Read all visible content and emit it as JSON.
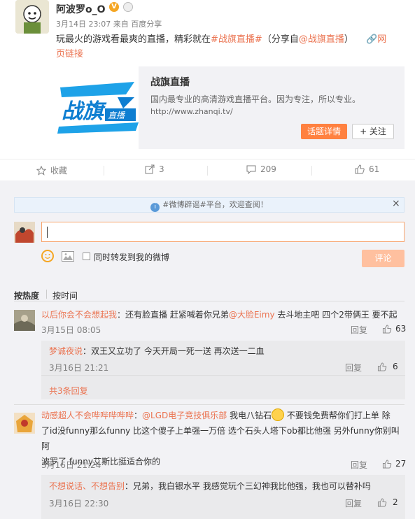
{
  "post": {
    "username": "阿波罗o_O",
    "verified_badge": "V",
    "time": "3月14日 23:07",
    "source": "来自 百度分享",
    "text_prefix": "玩最火的游戏看最爽的直播，精彩就在",
    "topic": "#战旗直播#",
    "text_mid": "（分享自",
    "share_from": "@战旗直播",
    "text_suffix": "）",
    "web_link_line1": "网",
    "web_link_line2": "页链接"
  },
  "card": {
    "logo_text": "战旗",
    "logo_sub": "直播",
    "title": "战旗直播",
    "description": "国内最专业的高清游戏直播平台。因为专注，所以专业。",
    "url": "http://www.zhanqi.tv/",
    "topic_button": "话题详情",
    "follow_button": "+ 关注"
  },
  "actions": {
    "favorite": "收藏",
    "forward": "3",
    "comment": "209",
    "like": "61"
  },
  "comment_box": {
    "notice": "#微博辟谣#平台，欢迎查阅！",
    "close": "×",
    "repost_label": "同时转发到我的微博",
    "submit": "评论"
  },
  "sort": {
    "hot": "按热度",
    "time": "按时间"
  },
  "comments": [
    {
      "user": "以后你会不会想起我",
      "text": "：还有脸直播  赶紧喊着你兄弟@大脸Eimy  去斗地主吧  四个2带俩王  要不起",
      "mention": "@大脸Eimy",
      "time": "3月15日 08:05",
      "reply": "回复",
      "likes": "63",
      "sub": {
        "user": "梦诚夜说",
        "text": "：双王又立功了 今天开局一死一送 再次送一二血",
        "time": "3月16日 21:21",
        "reply": "回复",
        "likes": "6"
      },
      "more": "共3条回复"
    },
    {
      "user": "动感超人不会哔哔哔哔哔",
      "text_line1_pre": "：",
      "mention": "@LGD电子竞技俱乐部",
      "text_line1_mid": " 我电八钻石",
      "text_line1_post": " 不要钱免费帮你们打上单  除",
      "text_line2": "了id没funny那么funny 比这个傻子上单强一万倍  选个石头人塔下ob都比他强  另外funny你别叫阿",
      "text_line3": "波罗了 funny艾斯比挺适合你的",
      "time": "3月16日 21:24",
      "reply": "回复",
      "likes": "27",
      "sub": {
        "user": "不想说话、不想告别",
        "text": "：兄弟，我白银水平 我感觉玩个三幻神我比他强，我也可以替补吗",
        "time": "3月16日 22:30",
        "reply": "回复",
        "likes": "2"
      }
    }
  ]
}
